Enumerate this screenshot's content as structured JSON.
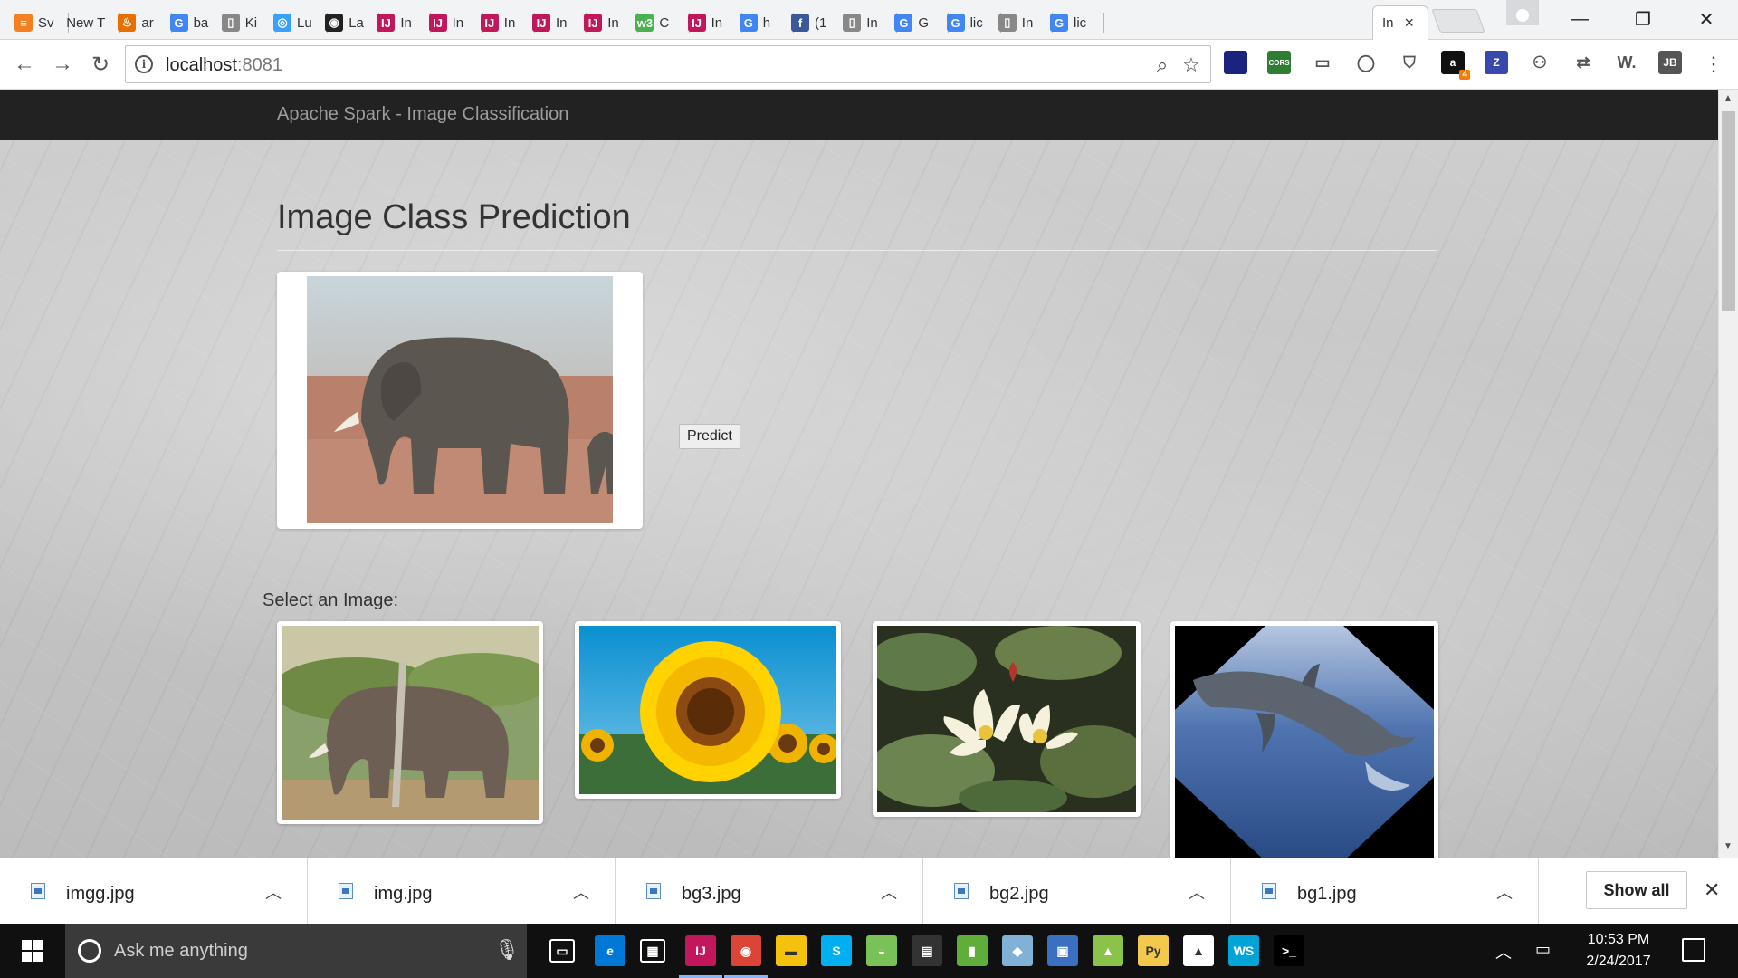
{
  "browser": {
    "tabs": [
      {
        "label": "Sv",
        "icon": "stack-icon",
        "color": "#f48024"
      },
      {
        "label": "New T",
        "icon": "",
        "color": ""
      },
      {
        "label": "ar",
        "icon": "java-icon",
        "color": "#e76f00"
      },
      {
        "label": "ba",
        "icon": "google-icon",
        "color": "#4285f4"
      },
      {
        "label": "Ki",
        "icon": "page-icon",
        "color": "#888888"
      },
      {
        "label": "Lu",
        "icon": "lucene-icon",
        "color": "#3aa0ff"
      },
      {
        "label": "La",
        "icon": "github-icon",
        "color": "#222222"
      },
      {
        "label": "In",
        "icon": "intellij-icon",
        "color": "#c2185b"
      },
      {
        "label": "In",
        "icon": "intellij-icon",
        "color": "#c2185b"
      },
      {
        "label": "In",
        "icon": "intellij-icon",
        "color": "#c2185b"
      },
      {
        "label": "In",
        "icon": "intellij-icon",
        "color": "#c2185b"
      },
      {
        "label": "In",
        "icon": "intellij-icon",
        "color": "#c2185b"
      },
      {
        "label": "C",
        "icon": "w3-icon",
        "color": "#4caf50"
      },
      {
        "label": "In",
        "icon": "intellij-icon",
        "color": "#c2185b"
      },
      {
        "label": "h",
        "icon": "google-icon",
        "color": "#4285f4"
      },
      {
        "label": "(1",
        "icon": "facebook-icon",
        "color": "#3b5998"
      },
      {
        "label": "In",
        "icon": "page-icon",
        "color": "#888888"
      },
      {
        "label": "G",
        "icon": "google-icon",
        "color": "#4285f4"
      },
      {
        "label": "lic",
        "icon": "google-icon",
        "color": "#4285f4"
      },
      {
        "label": "In",
        "icon": "page-icon",
        "color": "#888888"
      },
      {
        "label": "lic",
        "icon": "google-icon",
        "color": "#4285f4"
      }
    ],
    "active_tab": {
      "label": "In"
    },
    "url_host": "localhost",
    "url_port": ":8081",
    "extensions": [
      {
        "name": "extension-icon-1",
        "text": "",
        "color": "#1a237e"
      },
      {
        "name": "cors-extension-icon",
        "text": "CORS",
        "color": "#2e7d32"
      },
      {
        "name": "cast-icon",
        "text": "▭",
        "color": "#ffffff"
      },
      {
        "name": "circle-extension-icon",
        "text": "◯",
        "color": "#ffffff"
      },
      {
        "name": "shield-extension-icon",
        "text": "⛉",
        "color": "#ffffff"
      },
      {
        "name": "amazon-extension-icon",
        "text": "a",
        "color": "#111111"
      },
      {
        "name": "zotero-extension-icon",
        "text": "Z",
        "color": "#3949ab"
      },
      {
        "name": "glasses-extension-icon",
        "text": "⚇",
        "color": "#ffffff"
      },
      {
        "name": "translate-extension-icon",
        "text": "⇄",
        "color": "#ffffff"
      },
      {
        "name": "w-extension-icon",
        "text": "W.",
        "color": "#ffffff"
      },
      {
        "name": "jb-extension-icon",
        "text": "JB",
        "color": "#555555"
      }
    ],
    "amazon_badge": "4"
  },
  "page": {
    "brand": "Apache Spark - Image Classification",
    "title": "Image Class Prediction",
    "predict_label": "Predict",
    "select_label": "Select an Image:"
  },
  "downloads": {
    "items": [
      "imgg.jpg",
      "img.jpg",
      "bg3.jpg",
      "bg2.jpg",
      "bg1.jpg"
    ],
    "show_all": "Show all"
  },
  "taskbar": {
    "search_placeholder": "Ask me anything",
    "time": "10:53 PM",
    "date": "2/24/2017",
    "apps": [
      {
        "name": "task-view-icon",
        "text": "▭",
        "color": "#101010"
      },
      {
        "name": "edge-icon",
        "text": "e",
        "color": "#0078d7"
      },
      {
        "name": "store-icon",
        "text": "▦",
        "color": "#101010"
      },
      {
        "name": "intellij-icon",
        "text": "IJ",
        "color": "#c2185b"
      },
      {
        "name": "chrome-icon",
        "text": "◉",
        "color": "#db4437"
      },
      {
        "name": "file-explorer-icon",
        "text": "▬",
        "color": "#f4c20d"
      },
      {
        "name": "skype-icon",
        "text": "S",
        "color": "#00aff0"
      },
      {
        "name": "android-icon",
        "text": "◒",
        "color": "#78c257"
      },
      {
        "name": "clapper-icon",
        "text": "▤",
        "color": "#333333"
      },
      {
        "name": "notepad-icon",
        "text": "▮",
        "color": "#5fae3b"
      },
      {
        "name": "shape-app-icon",
        "text": "◆",
        "color": "#7fb2d6"
      },
      {
        "name": "monitor-app-icon",
        "text": "▣",
        "color": "#3b6fc1"
      },
      {
        "name": "chart-app-icon",
        "text": "▲",
        "color": "#8bc34a"
      },
      {
        "name": "python-file-icon",
        "text": "Py",
        "color": "#f2c94c"
      },
      {
        "name": "photos-icon",
        "text": "▲",
        "color": "#ffffff"
      },
      {
        "name": "webstorm-icon",
        "text": "WS",
        "color": "#00a4d6"
      },
      {
        "name": "terminal-icon",
        "text": ">_",
        "color": "#000000"
      }
    ]
  }
}
